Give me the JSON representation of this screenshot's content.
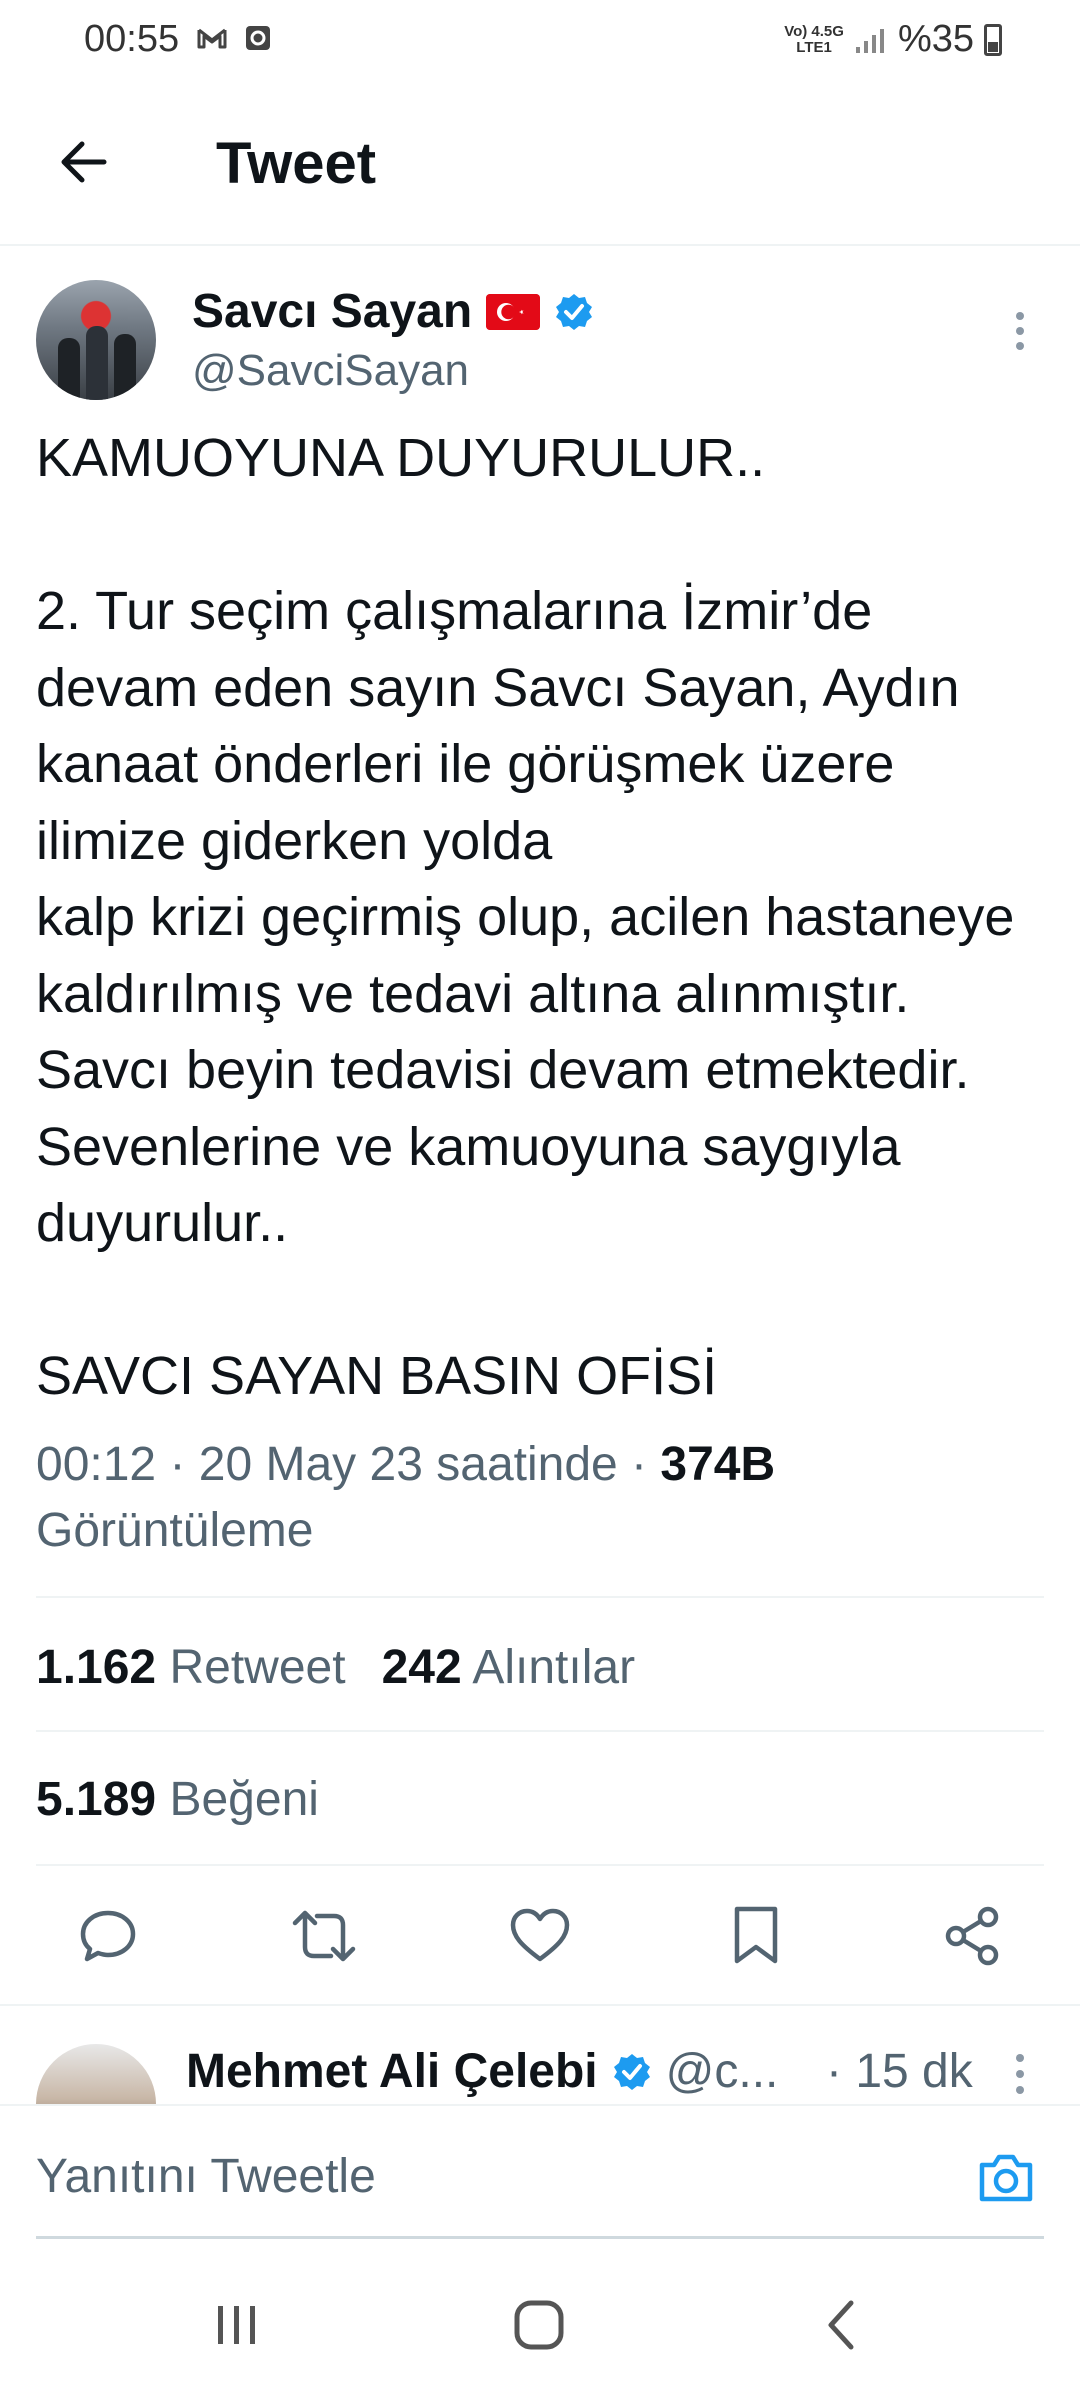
{
  "status_bar": {
    "time": "00:55",
    "network_top": "Vo) 4.5G",
    "network_bottom": "LTE1",
    "battery": "%35"
  },
  "header": {
    "title": "Tweet"
  },
  "tweet": {
    "author_name": "Savcı Sayan",
    "author_handle": "@SavciSayan",
    "text": "KAMUOYUNA DUYURULUR..\n\n2. Tur seçim çalışmalarına İzmir’de devam eden sayın Savcı Sayan, Aydın kanaat önderleri ile görüşmek üzere ilimize giderken yolda\nkalp krizi geçirmiş olup, acilen hastaneye kaldırılmış ve tedavi altına alınmıştır. Savcı beyin tedavisi devam etmektedir. Sevenlerine ve kamuoyuna saygıyla duyurulur..\n\nSAVCI SAYAN BASIN OFİSİ",
    "timestamp": "00:12 · 20 May 23 saatinde · ",
    "views_count": "374B",
    "views_label": " Görüntüleme"
  },
  "stats": {
    "retweets": "1.162",
    "retweets_label": "Retweet",
    "quotes": "242",
    "quotes_label": "Alıntılar",
    "likes": "5.189",
    "likes_label": "Beğeni"
  },
  "actions": [
    "reply-icon",
    "retweet-icon",
    "like-icon",
    "bookmark-icon",
    "share-icon"
  ],
  "reply_preview": {
    "name": "Mehmet Ali Çelebi",
    "handle": "@c...",
    "time": "· 15 dk"
  },
  "composer": {
    "placeholder": "Yanıtını Tweetle"
  },
  "colors": {
    "accent": "#1d9bf0",
    "text_primary": "#0f1419",
    "text_secondary": "#536471",
    "divider": "#eff3f4"
  }
}
